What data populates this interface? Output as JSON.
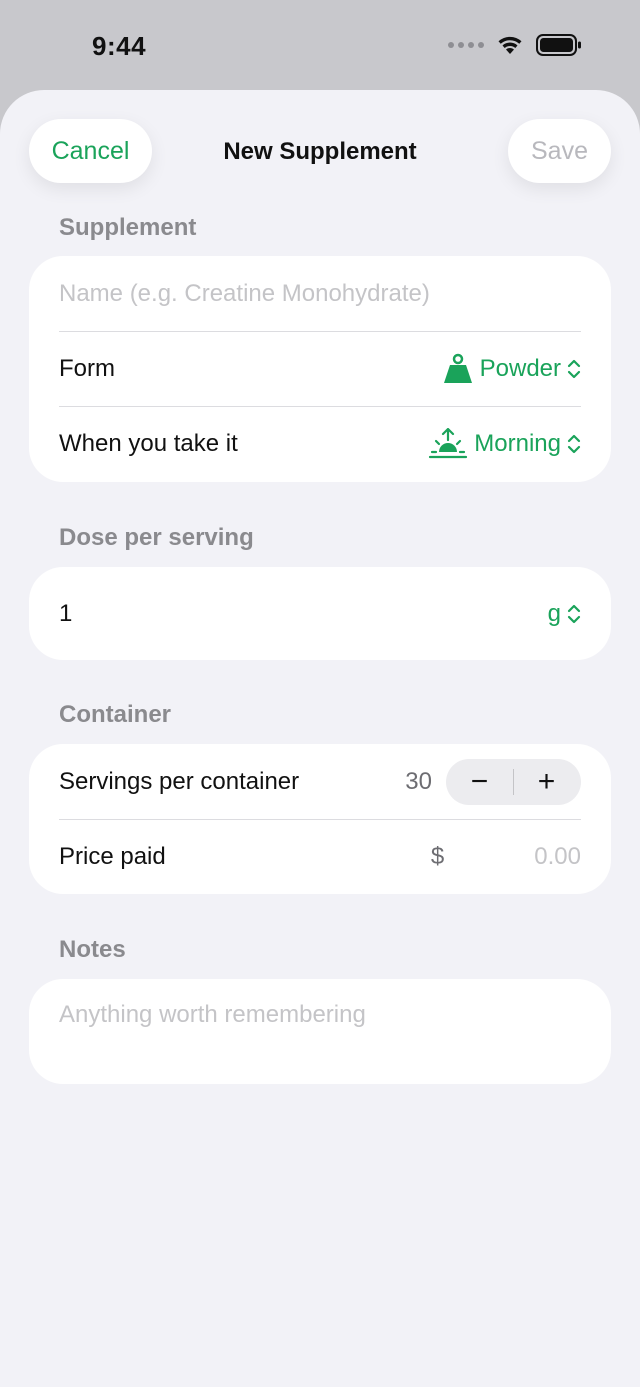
{
  "status_bar": {
    "time": "9:44"
  },
  "nav": {
    "cancel_label": "Cancel",
    "title": "New Supplement",
    "save_label": "Save"
  },
  "supplement_section": {
    "header": "Supplement",
    "name_placeholder": "Name (e.g. Creatine Monohydrate)",
    "form_label": "Form",
    "form_value": "Powder",
    "form_icon": "kettlebell-icon",
    "timing_label": "When you take it",
    "timing_value": "Morning",
    "timing_icon": "sunrise-icon"
  },
  "dose_section": {
    "header": "Dose per serving",
    "value": "1",
    "unit": "g"
  },
  "container_section": {
    "header": "Container",
    "servings_label": "Servings per container",
    "servings_value": "30",
    "minus": "−",
    "plus": "+",
    "price_label": "Price paid",
    "currency": "$",
    "price_placeholder": "0.00"
  },
  "notes_section": {
    "header": "Notes",
    "placeholder": "Anything worth remembering"
  },
  "colors": {
    "accent": "#1aa35a",
    "background": "#f2f2f7",
    "card": "#ffffff",
    "secondary_text": "#8a8a8e",
    "placeholder": "#c4c4c7"
  }
}
